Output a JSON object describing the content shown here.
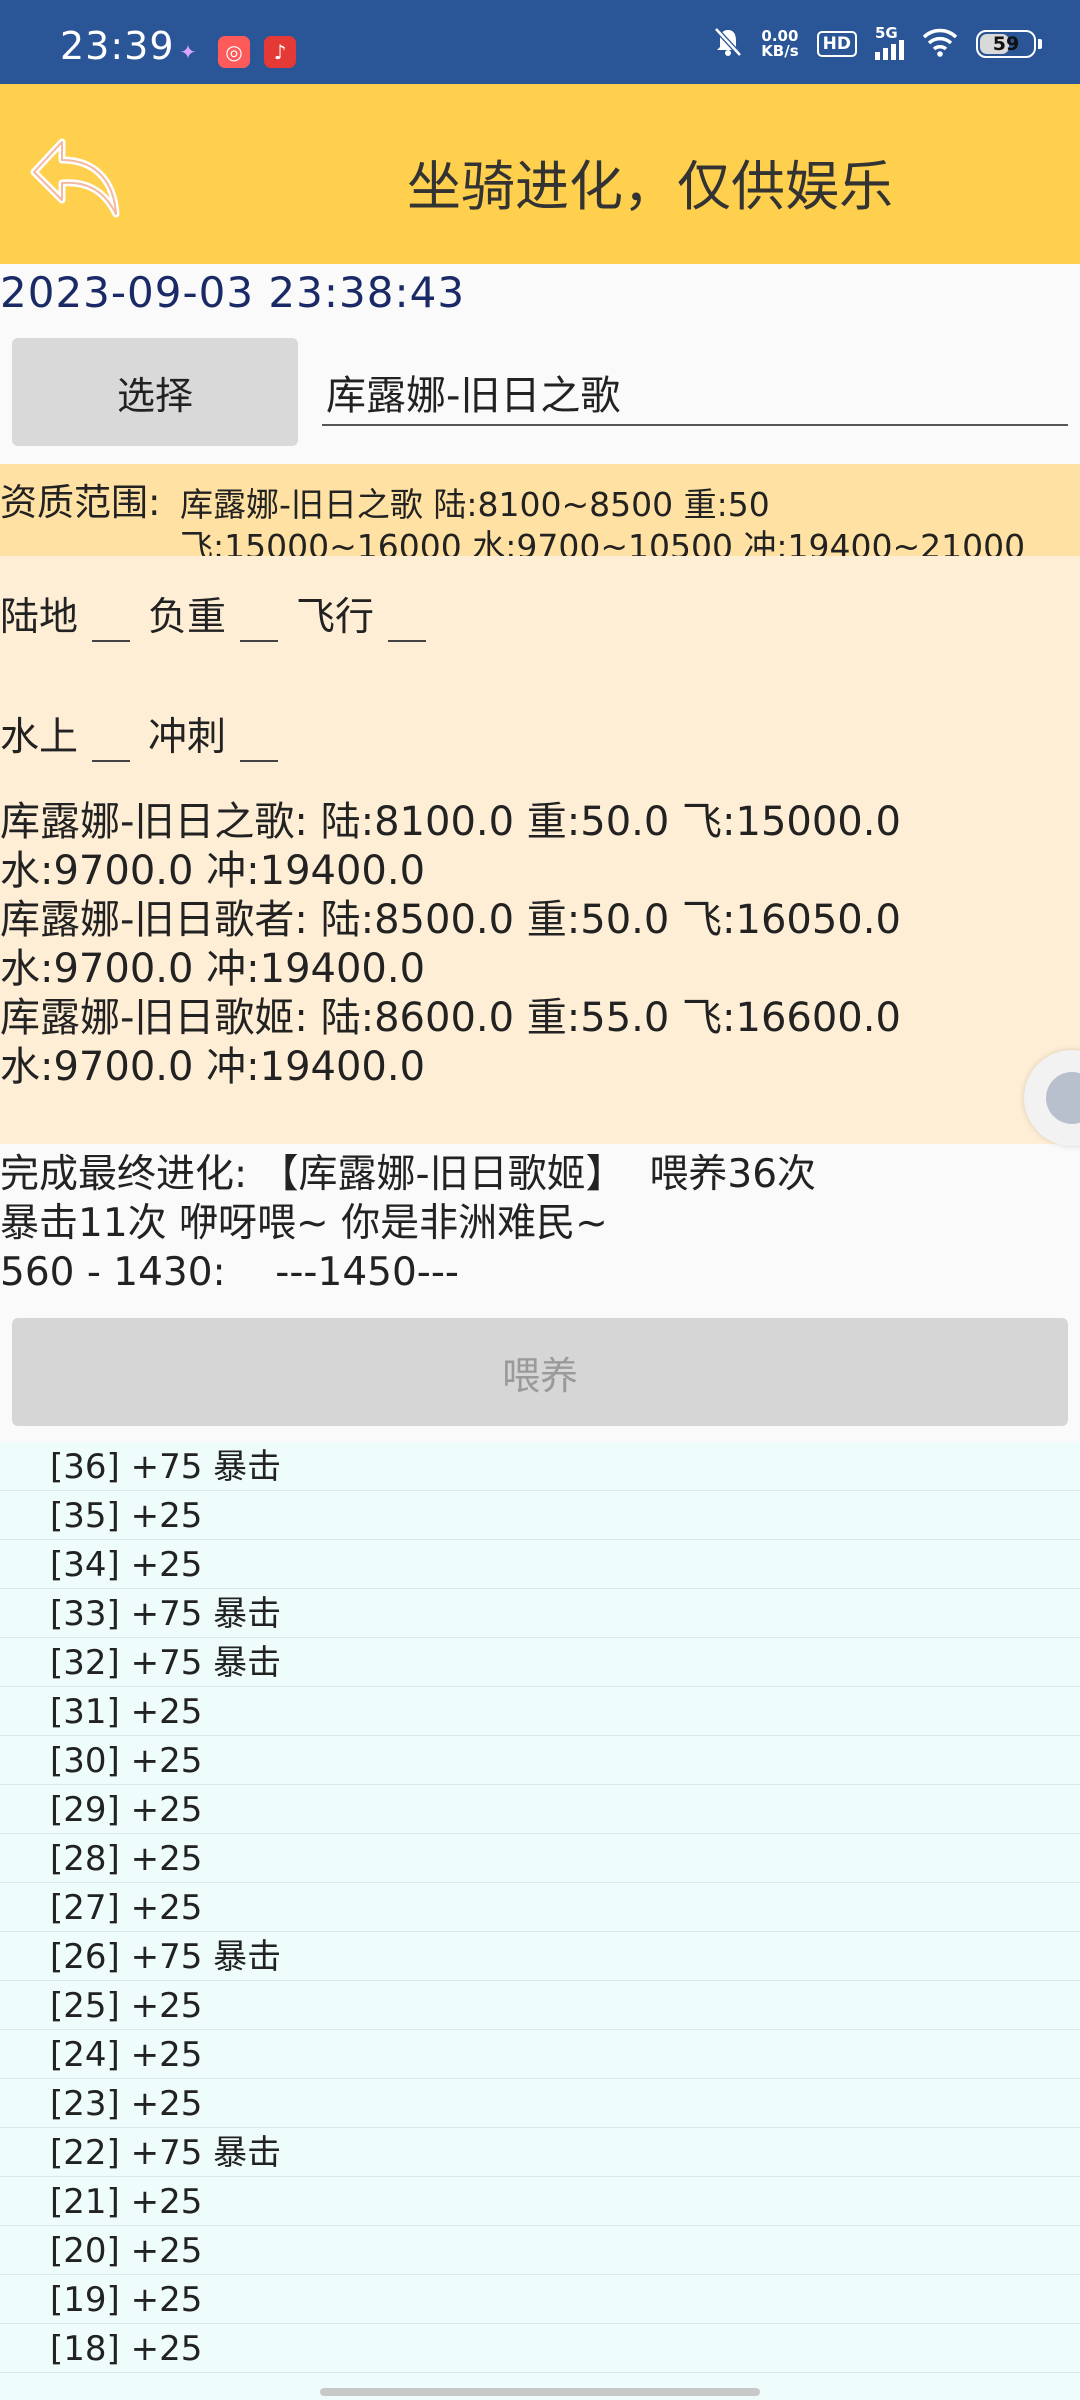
{
  "status_bar": {
    "time": "23:39",
    "net_speed_value": "0.00",
    "net_speed_unit": "KB/s",
    "hd": "HD",
    "network": "5G",
    "battery": "59"
  },
  "header": {
    "title": "坐骑进化，仅供娱乐"
  },
  "timestamp": "2023-09-03 23:38:43",
  "select": {
    "button_label": "选择",
    "value": "库露娜-旧日之歌"
  },
  "range": {
    "label": "资质范围:",
    "line1": "库露娜-旧日之歌 陆:8100~8500 重:50",
    "line2": "飞:15000~16000 水:9700~10500 冲:19400~21000"
  },
  "stats": {
    "land": "陆地",
    "load": "负重",
    "fly": "飞行",
    "water": "水上",
    "sprint": "冲刺"
  },
  "mount_lines": [
    "库露娜-旧日之歌: 陆:8100.0 重:50.0 飞:15000.0",
    "水:9700.0 冲:19400.0",
    "库露娜-旧日歌者: 陆:8500.0 重:50.0 飞:16050.0",
    "水:9700.0 冲:19400.0",
    "库露娜-旧日歌姬: 陆:8600.0 重:55.0 飞:16600.0",
    "水:9700.0 冲:19400.0"
  ],
  "result": {
    "line1": "完成最终进化: 【库露娜-旧日歌姬】  喂养36次",
    "line2": "暴击11次 咿呀喂~ 你是非洲难民~",
    "line3": "560 - 1430:    ---1450---"
  },
  "feed_button": "喂养",
  "log": [
    "[36] +75 暴击",
    "[35] +25",
    "[34] +25",
    "[33] +75 暴击",
    "[32] +75 暴击",
    "[31] +25",
    "[30] +25",
    "[29] +25",
    "[28] +25",
    "[27] +25",
    "[26] +75 暴击",
    "[25] +25",
    "[24] +25",
    "[23] +25",
    "[22] +75 暴击",
    "[21] +25",
    "[20] +25",
    "[19] +25",
    "[18] +25"
  ]
}
